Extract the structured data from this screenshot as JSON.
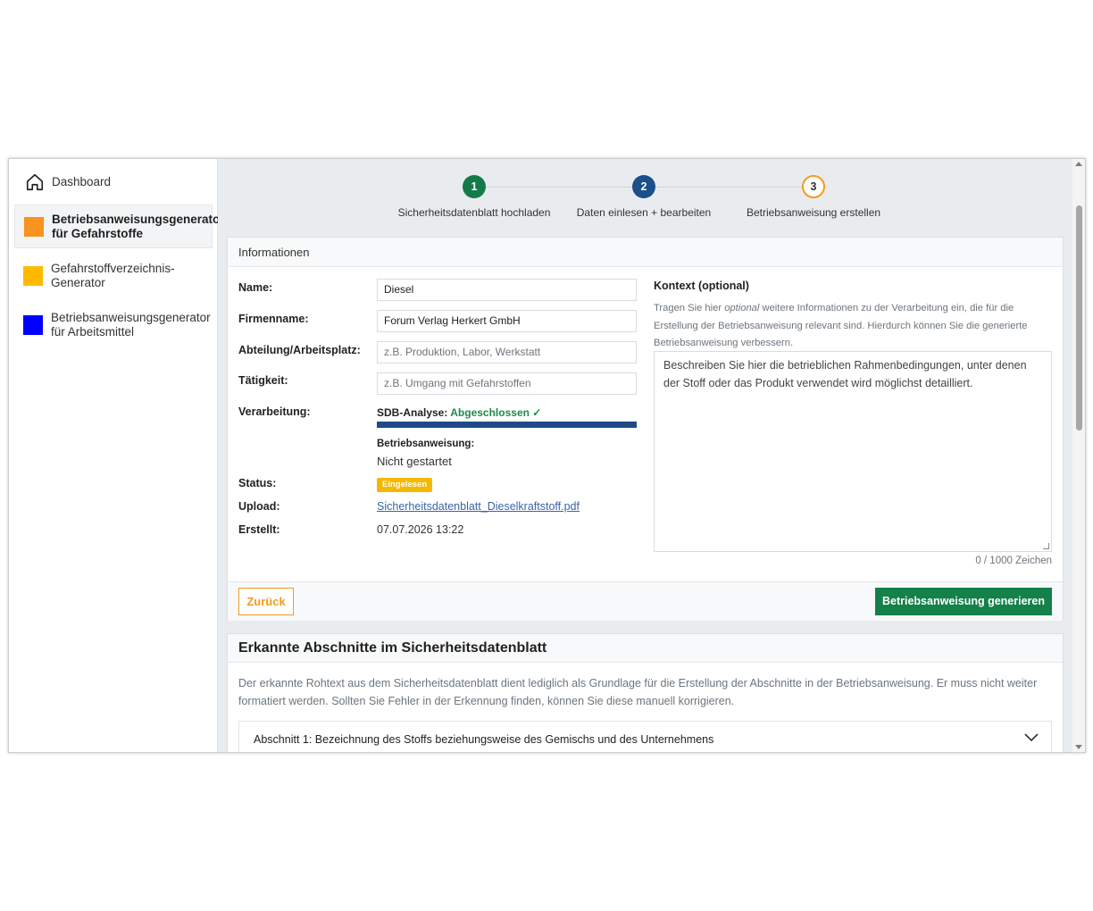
{
  "sidebar": {
    "items": [
      {
        "label": "Dashboard",
        "icon": "home-icon"
      },
      {
        "label": "Betriebsanweisungsgenerator für Gefahrstoffe",
        "color": "#f7931e",
        "active": true
      },
      {
        "label": "Gefahrstoffverzeichnis-Generator",
        "color": "#ffba00"
      },
      {
        "label": "Betriebsanweisungsgenerator für Arbeitsmittel",
        "color": "#0000ff"
      }
    ]
  },
  "stepper": {
    "steps": [
      {
        "number": "1",
        "label": "Sicherheitsdatenblatt hochladen"
      },
      {
        "number": "2",
        "label": "Daten einlesen + bearbeiten"
      },
      {
        "number": "3",
        "label": "Betriebsanweisung erstellen"
      }
    ]
  },
  "info": {
    "title": "Informationen",
    "labels": {
      "name": "Name:",
      "firm": "Firmenname:",
      "dept": "Abteilung/Arbeitsplatz:",
      "activity": "Tätigkeit:",
      "processing": "Verarbeitung:",
      "status": "Status:",
      "upload": "Upload:",
      "created": "Erstellt:"
    },
    "name_value": "Diesel",
    "firm_value": "Forum Verlag Herkert GmbH",
    "dept_placeholder": "z.B. Produktion, Labor, Werkstatt",
    "activity_placeholder": "z.B. Umgang mit Gefahrstoffen",
    "sdb_label": "SDB-Analyse:",
    "sdb_status": "Abgeschlossen ✓",
    "sdb_progress": 1.0,
    "ba_label": "Betriebsanweisung:",
    "ba_status": "Nicht gestartet",
    "status_badge": "Eingelesen",
    "upload_file": "Sicherheitsdatenblatt_Dieselkraftstoff.pdf",
    "created_value": "07.07.2026 13:22"
  },
  "context": {
    "title": "Kontext (optional)",
    "help_before": "Tragen Sie hier ",
    "help_em": "optional",
    "help_after": " weitere Informationen zu der Verarbeitung ein, die für die Erstellung der Betriebsanweisung relevant sind. Hierdurch können Sie die generierte Betriebsanweisung verbessern.",
    "placeholder": "Beschreiben Sie hier die betrieblichen Rahmenbedingungen, unter denen der Stoff oder das Produkt verwendet wird möglichst detailliert.",
    "counter": "0 / 1000 Zeichen"
  },
  "actions": {
    "back": "Zurück",
    "generate": "Betriebsanweisung generieren"
  },
  "sections": {
    "title": "Erkannte Abschnitte im Sicherheitsdatenblatt",
    "description": "Der erkannte Rohtext aus dem Sicherheitsdatenblatt dient lediglich als Grundlage für die Erstellung der Abschnitte in der Betriebsanweisung. Er muss nicht weiter formatiert werden. Sollten Sie Fehler in der Erkennung finden, können Sie diese manuell korrigieren.",
    "items": [
      {
        "title": "Abschnitt 1: Bezeichnung des Stoffs beziehungsweise des Gemischs und des Unternehmens"
      }
    ]
  },
  "colors": {
    "accent_orange": "#f39a1e",
    "primary_green": "#14804a",
    "step_blue": "#1a4f8a",
    "badge_yellow": "#f5b800"
  }
}
